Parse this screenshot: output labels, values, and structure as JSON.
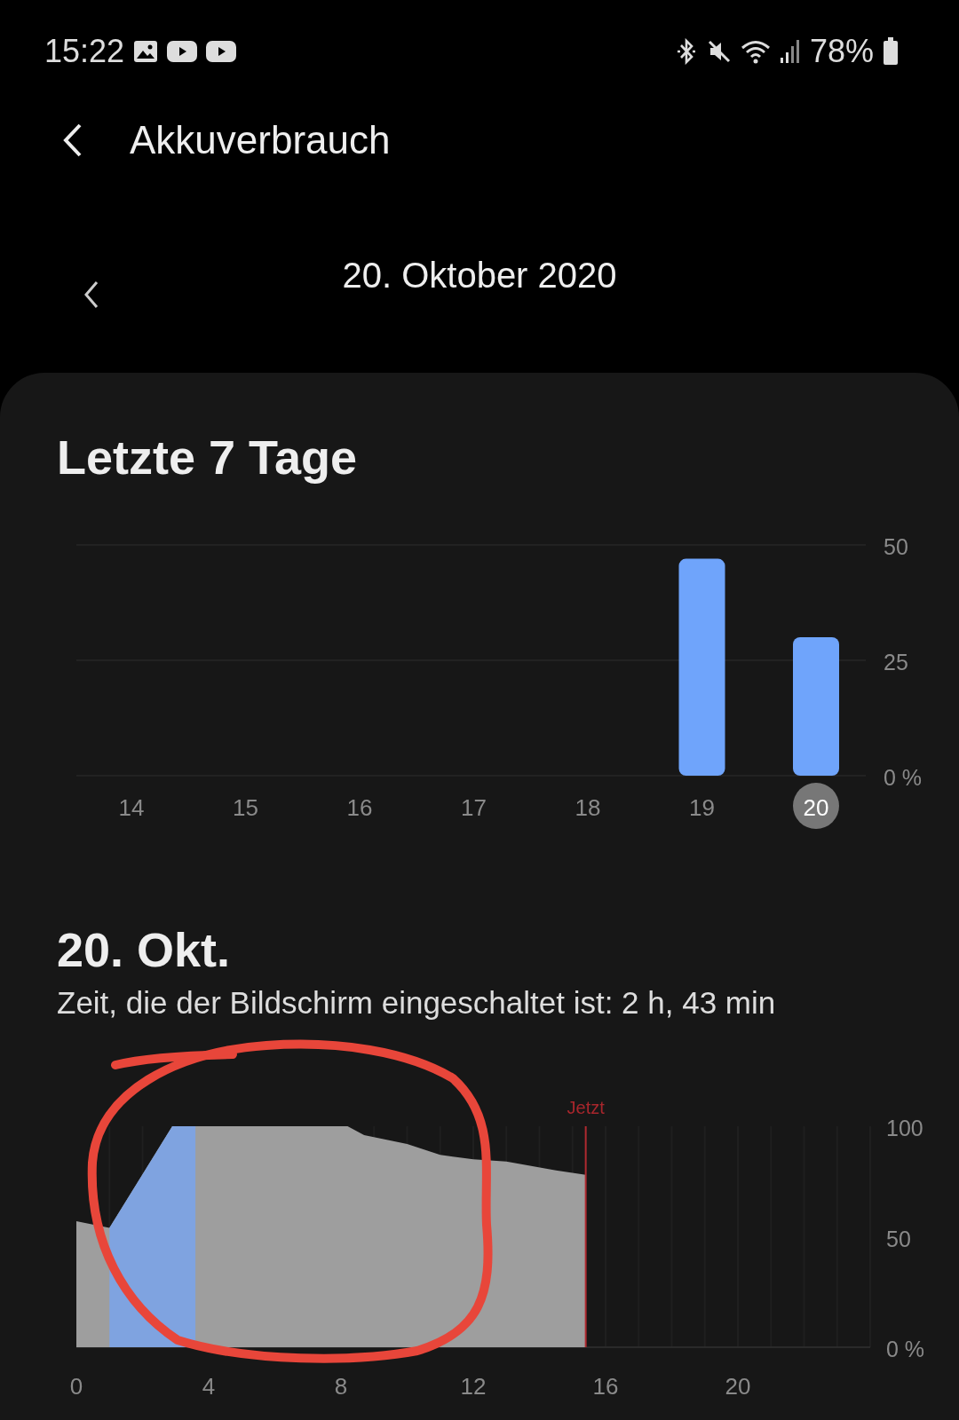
{
  "status_bar": {
    "time": "15:22",
    "battery_text": "78%"
  },
  "header": {
    "title": "Akkuverbrauch"
  },
  "date_nav": {
    "date": "20. Oktober 2020"
  },
  "week": {
    "title": "Letzte 7 Tage",
    "chart_data": {
      "type": "bar",
      "categories": [
        "14",
        "15",
        "16",
        "17",
        "18",
        "19",
        "20"
      ],
      "values": [
        0,
        0,
        0,
        0,
        0,
        47,
        30
      ],
      "ylim": [
        0,
        50
      ],
      "yticks": [
        {
          "value": 0,
          "label": "0 %"
        },
        25,
        50
      ],
      "grid": true
    },
    "selected_days": [
      false,
      false,
      false,
      false,
      false,
      false,
      true
    ]
  },
  "day": {
    "title": "20. Okt.",
    "subtitle": "Zeit, die der Bildschirm eingeschaltet ist: 2 h, 43 min",
    "chart_data": {
      "type": "area",
      "x": [
        0,
        1,
        2.9,
        3.6,
        8.2,
        8.7,
        10,
        11,
        12,
        13,
        14.5,
        15.4
      ],
      "series": [
        {
          "color": "#9e9e9e",
          "values": [
            57,
            54,
            100,
            100,
            100,
            96,
            92,
            87,
            85,
            84,
            80,
            78
          ]
        },
        {
          "color": "#7fa3e0",
          "values": [
            null,
            54,
            100,
            100,
            null,
            null,
            null,
            null,
            null,
            null,
            null,
            null
          ]
        }
      ],
      "xlim": [
        0,
        24
      ],
      "ylim": [
        0,
        100
      ],
      "xticks": [
        0,
        4,
        8,
        12,
        16,
        20
      ],
      "yticks": [
        {
          "value": 0,
          "label": "0 %"
        },
        50,
        100
      ],
      "grid": true,
      "annotations": [
        {
          "x": 15.4,
          "text": "Jetzt"
        }
      ]
    }
  }
}
